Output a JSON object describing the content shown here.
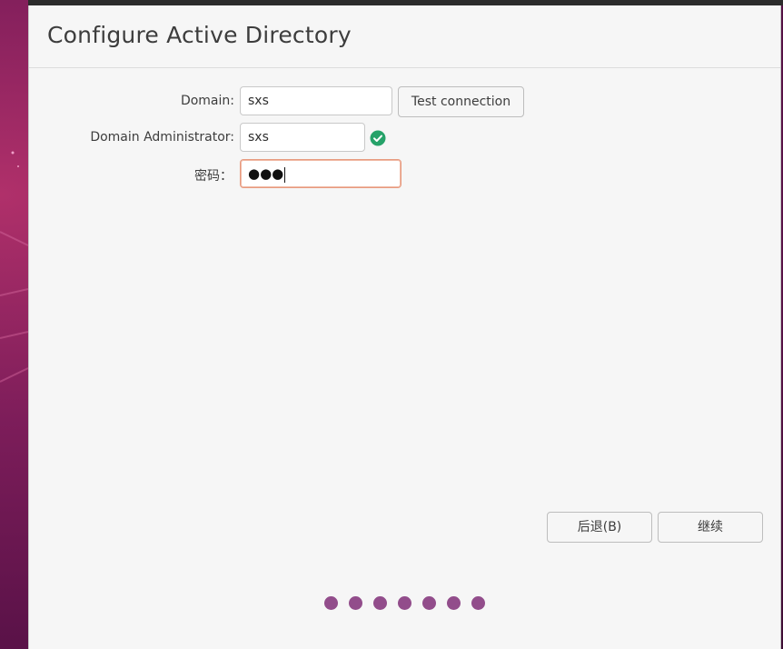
{
  "window": {
    "title": "Configure Active Directory"
  },
  "form": {
    "domain_label": "Domain:",
    "domain_value": "sxs",
    "test_connection_label": "Test connection",
    "admin_label": "Domain Administrator:",
    "admin_value": "sxs",
    "admin_status_icon": "check-circle-icon",
    "password_label": "密码：",
    "password_masked": "●●●"
  },
  "nav": {
    "back_label": "后退(B)",
    "continue_label": "继续"
  },
  "progress": {
    "total_steps": 7,
    "current_step": 7
  },
  "colors": {
    "accent_focus": "#e79a7f",
    "success_green": "#26a269",
    "progress_dot": "#924d8b"
  }
}
